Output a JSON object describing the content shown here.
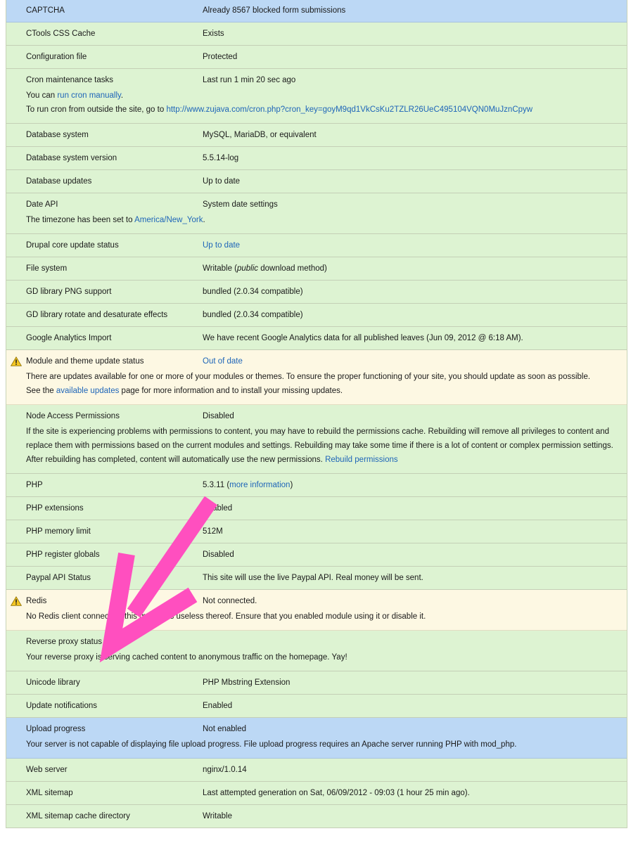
{
  "rows": [
    {
      "id": "captcha",
      "severity": "info",
      "title": "CAPTCHA",
      "value": "Already 8567 blocked form submissions"
    },
    {
      "id": "ctools",
      "severity": "ok",
      "title": "CTools CSS Cache",
      "value": "Exists"
    },
    {
      "id": "config",
      "severity": "ok",
      "title": "Configuration file",
      "value": "Protected"
    },
    {
      "id": "cron",
      "severity": "ok",
      "title": "Cron maintenance tasks",
      "value": "Last run 1 min 20 sec ago",
      "desc_line1_prefix": "You can ",
      "desc_line1_link": "run cron manually",
      "desc_line1_suffix": ".",
      "desc_line2_prefix": "To run cron from outside the site, go to ",
      "desc_line2_link": "http://www.zujava.com/cron.php?cron_key=goyM9qd1VkCsKu2TZLR26UeC495104VQN0MuJznCpyw"
    },
    {
      "id": "db-system",
      "severity": "ok",
      "title": "Database system",
      "value": "MySQL, MariaDB, or equivalent"
    },
    {
      "id": "db-version",
      "severity": "ok",
      "title": "Database system version",
      "value": "5.5.14-log"
    },
    {
      "id": "db-updates",
      "severity": "ok",
      "title": "Database updates",
      "value": "Up to date"
    },
    {
      "id": "date-api",
      "severity": "ok",
      "title": "Date API",
      "value": "System date settings",
      "desc_prefix": "The timezone has been set to ",
      "desc_link": "America/New_York",
      "desc_suffix": "."
    },
    {
      "id": "core-update",
      "severity": "ok",
      "title": "Drupal core update status",
      "value_link": "Up to date"
    },
    {
      "id": "file-system",
      "severity": "ok",
      "title": "File system",
      "value_prefix": "Writable (",
      "value_em": "public",
      "value_suffix": " download method)"
    },
    {
      "id": "gd-png",
      "severity": "ok",
      "title": "GD library PNG support",
      "value": "bundled (2.0.34 compatible)"
    },
    {
      "id": "gd-rotate",
      "severity": "ok",
      "title": "GD library rotate and desaturate effects",
      "value": "bundled (2.0.34 compatible)"
    },
    {
      "id": "ga-import",
      "severity": "ok",
      "title": "Google Analytics Import",
      "value": "We have recent Google Analytics data for all published leaves (Jun 09, 2012 @ 6:18 AM)."
    },
    {
      "id": "module-update",
      "severity": "warning",
      "title": "Module and theme update status",
      "value_link": "Out of date",
      "desc_line1": "There are updates available for one or more of your modules or themes. To ensure the proper functioning of your site, you should update as soon as possible.",
      "desc_line2_prefix": "See the ",
      "desc_line2_link": "available updates",
      "desc_line2_suffix": " page for more information and to install your missing updates."
    },
    {
      "id": "node-access",
      "severity": "ok",
      "title": "Node Access Permissions",
      "value": "Disabled",
      "desc_text": "If the site is experiencing problems with permissions to content, you may have to rebuild the permissions cache. Rebuilding will remove all privileges to content and replace them with permissions based on the current modules and settings. Rebuilding may take some time if there is a lot of content or complex permission settings. After rebuilding has completed, content will automatically use the new permissions. ",
      "desc_link": "Rebuild permissions"
    },
    {
      "id": "php",
      "severity": "ok",
      "title": "PHP",
      "value_prefix": "5.3.11 (",
      "value_link": "more information",
      "value_suffix": ")"
    },
    {
      "id": "php-ext",
      "severity": "ok",
      "title": "PHP extensions",
      "value": "Enabled"
    },
    {
      "id": "php-mem",
      "severity": "ok",
      "title": "PHP memory limit",
      "value": "512M"
    },
    {
      "id": "php-globals",
      "severity": "ok",
      "title": "PHP register globals",
      "value": "Disabled"
    },
    {
      "id": "paypal",
      "severity": "ok",
      "title": "Paypal API Status",
      "value": "This site will use the live Paypal API. Real money will be sent."
    },
    {
      "id": "redis",
      "severity": "warning",
      "title": "Redis",
      "value": "Not connected.",
      "desc": "No Redis client connected, this module is useless thereof. Ensure that you enabled module using it or disable it."
    },
    {
      "id": "reverse-proxy",
      "severity": "ok",
      "title": "Reverse proxy status",
      "value": "",
      "desc": "Your reverse proxy is serving cached content to anonymous traffic on the homepage. Yay!"
    },
    {
      "id": "unicode",
      "severity": "ok",
      "title": "Unicode library",
      "value": "PHP Mbstring Extension"
    },
    {
      "id": "update-notif",
      "severity": "ok",
      "title": "Update notifications",
      "value": "Enabled"
    },
    {
      "id": "upload-progress",
      "severity": "info",
      "title": "Upload progress",
      "value": "Not enabled",
      "desc": "Your server is not capable of displaying file upload progress. File upload progress requires an Apache server running PHP with mod_php."
    },
    {
      "id": "web-server",
      "severity": "ok",
      "title": "Web server",
      "value": "nginx/1.0.14"
    },
    {
      "id": "xml-sitemap",
      "severity": "ok",
      "title": "XML sitemap",
      "value": "Last attempted generation on Sat, 06/09/2012 - 09:03 (1 hour 25 min ago)."
    },
    {
      "id": "xml-cache",
      "severity": "ok",
      "title": "XML sitemap cache directory",
      "value": "Writable"
    }
  ],
  "colors": {
    "ok": "#ddf3d2",
    "info": "#bcd8f5",
    "warning": "#fdf8e3",
    "link": "#1e65b8",
    "arrow": "#ff4fbf"
  },
  "icons": {
    "warning": "warning-icon",
    "annotation": "pink-arrow-annotation"
  }
}
